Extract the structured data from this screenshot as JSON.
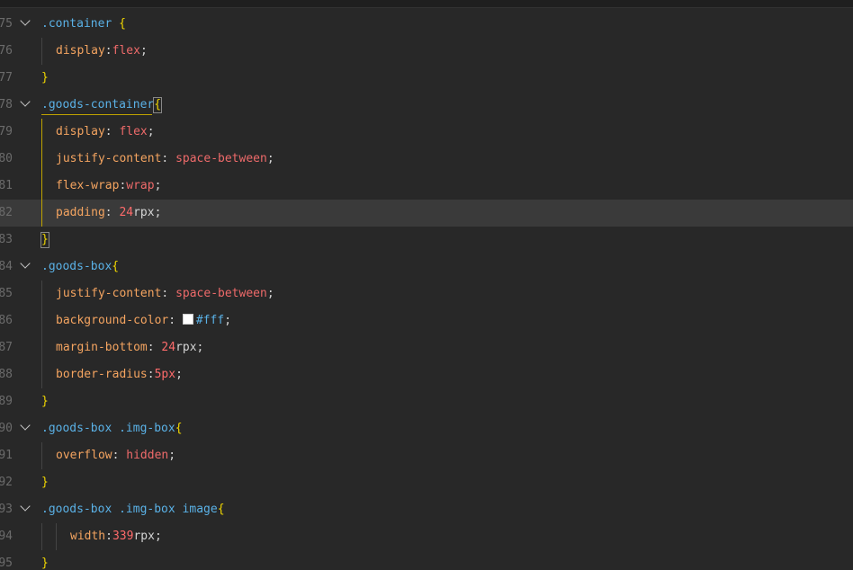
{
  "lines": [
    {
      "n": "75",
      "foldable": true,
      "indent": 0,
      "tokens": [
        {
          "t": ".container",
          "c": "sel"
        },
        {
          "t": " ",
          "c": "punct"
        },
        {
          "t": "{",
          "c": "brace"
        }
      ]
    },
    {
      "n": "76",
      "foldable": false,
      "indent": 1,
      "tokens": [
        {
          "t": "display",
          "c": "prop"
        },
        {
          "t": ":",
          "c": "punct"
        },
        {
          "t": "flex",
          "c": "val"
        },
        {
          "t": ";",
          "c": "punct"
        }
      ]
    },
    {
      "n": "77",
      "foldable": false,
      "indent": 0,
      "tokens": [
        {
          "t": "}",
          "c": "brace"
        }
      ]
    },
    {
      "n": "78",
      "foldable": true,
      "indent": 0,
      "tokens": [
        {
          "t": ".goods-container",
          "c": "sel"
        },
        {
          "t": "{",
          "c": "brace",
          "box": true
        }
      ]
    },
    {
      "n": "79",
      "foldable": false,
      "indent": 1,
      "tokens": [
        {
          "t": "display",
          "c": "prop"
        },
        {
          "t": ": ",
          "c": "punct"
        },
        {
          "t": "flex",
          "c": "val"
        },
        {
          "t": ";",
          "c": "punct"
        }
      ]
    },
    {
      "n": "80",
      "foldable": false,
      "indent": 1,
      "tokens": [
        {
          "t": "justify-content",
          "c": "prop"
        },
        {
          "t": ": ",
          "c": "punct"
        },
        {
          "t": "space-between",
          "c": "val"
        },
        {
          "t": ";",
          "c": "punct"
        }
      ]
    },
    {
      "n": "81",
      "foldable": false,
      "indent": 1,
      "tokens": [
        {
          "t": "flex-wrap",
          "c": "prop"
        },
        {
          "t": ":",
          "c": "punct"
        },
        {
          "t": "wrap",
          "c": "val"
        },
        {
          "t": ";",
          "c": "punct"
        }
      ]
    },
    {
      "n": "82",
      "foldable": false,
      "indent": 1,
      "current": true,
      "tokens": [
        {
          "t": "padding",
          "c": "prop"
        },
        {
          "t": ": ",
          "c": "punct"
        },
        {
          "t": "24",
          "c": "num"
        },
        {
          "t": "rpx",
          "c": "unit"
        },
        {
          "t": ";",
          "c": "punct"
        }
      ]
    },
    {
      "n": "83",
      "foldable": false,
      "indent": 0,
      "tokens": [
        {
          "t": "}",
          "c": "brace",
          "box": true
        }
      ]
    },
    {
      "n": "84",
      "foldable": true,
      "indent": 0,
      "tokens": [
        {
          "t": ".goods-box",
          "c": "sel"
        },
        {
          "t": "{",
          "c": "brace"
        }
      ]
    },
    {
      "n": "85",
      "foldable": false,
      "indent": 1,
      "tokens": [
        {
          "t": "justify-content",
          "c": "prop"
        },
        {
          "t": ": ",
          "c": "punct"
        },
        {
          "t": "space-between",
          "c": "val"
        },
        {
          "t": ";",
          "c": "punct"
        }
      ]
    },
    {
      "n": "86",
      "foldable": false,
      "indent": 1,
      "tokens": [
        {
          "t": "background-color",
          "c": "prop"
        },
        {
          "t": ": ",
          "c": "punct"
        },
        {
          "t": "",
          "c": "swatch"
        },
        {
          "t": "#fff",
          "c": "sel"
        },
        {
          "t": ";",
          "c": "punct"
        }
      ]
    },
    {
      "n": "87",
      "foldable": false,
      "indent": 1,
      "tokens": [
        {
          "t": "margin-bottom",
          "c": "prop"
        },
        {
          "t": ": ",
          "c": "punct"
        },
        {
          "t": "24",
          "c": "num"
        },
        {
          "t": "rpx",
          "c": "unit"
        },
        {
          "t": ";",
          "c": "punct"
        }
      ]
    },
    {
      "n": "88",
      "foldable": false,
      "indent": 1,
      "tokens": [
        {
          "t": "border-radius",
          "c": "prop"
        },
        {
          "t": ":",
          "c": "punct"
        },
        {
          "t": "5px",
          "c": "num"
        },
        {
          "t": ";",
          "c": "punct"
        }
      ]
    },
    {
      "n": "89",
      "foldable": false,
      "indent": 0,
      "tokens": [
        {
          "t": "}",
          "c": "brace"
        }
      ]
    },
    {
      "n": "90",
      "foldable": true,
      "indent": 0,
      "tokens": [
        {
          "t": ".goods-box .img-box",
          "c": "sel"
        },
        {
          "t": "{",
          "c": "brace"
        }
      ]
    },
    {
      "n": "91",
      "foldable": false,
      "indent": 1,
      "tokens": [
        {
          "t": "overflow",
          "c": "prop"
        },
        {
          "t": ": ",
          "c": "punct"
        },
        {
          "t": "hidden",
          "c": "val"
        },
        {
          "t": ";",
          "c": "punct"
        }
      ]
    },
    {
      "n": "92",
      "foldable": false,
      "indent": 0,
      "tokens": [
        {
          "t": "}",
          "c": "brace"
        }
      ]
    },
    {
      "n": "93",
      "foldable": true,
      "indent": 0,
      "tokens": [
        {
          "t": ".goods-box .img-box ",
          "c": "sel"
        },
        {
          "t": "image",
          "c": "sel"
        },
        {
          "t": "{",
          "c": "brace"
        }
      ]
    },
    {
      "n": "94",
      "foldable": false,
      "indent": 2,
      "tokens": [
        {
          "t": "width",
          "c": "prop"
        },
        {
          "t": ":",
          "c": "punct"
        },
        {
          "t": "339",
          "c": "num"
        },
        {
          "t": "rpx",
          "c": "unit"
        },
        {
          "t": ";",
          "c": "punct"
        }
      ]
    },
    {
      "n": "95",
      "foldable": false,
      "indent": 0,
      "tokens": [
        {
          "t": "}",
          "c": "brace"
        }
      ]
    }
  ],
  "colors": {
    "background": "#282828",
    "selector": "#5ab1e6",
    "brace": "#f1d700",
    "property": "#f4a460",
    "value": "#ee6a6a"
  }
}
